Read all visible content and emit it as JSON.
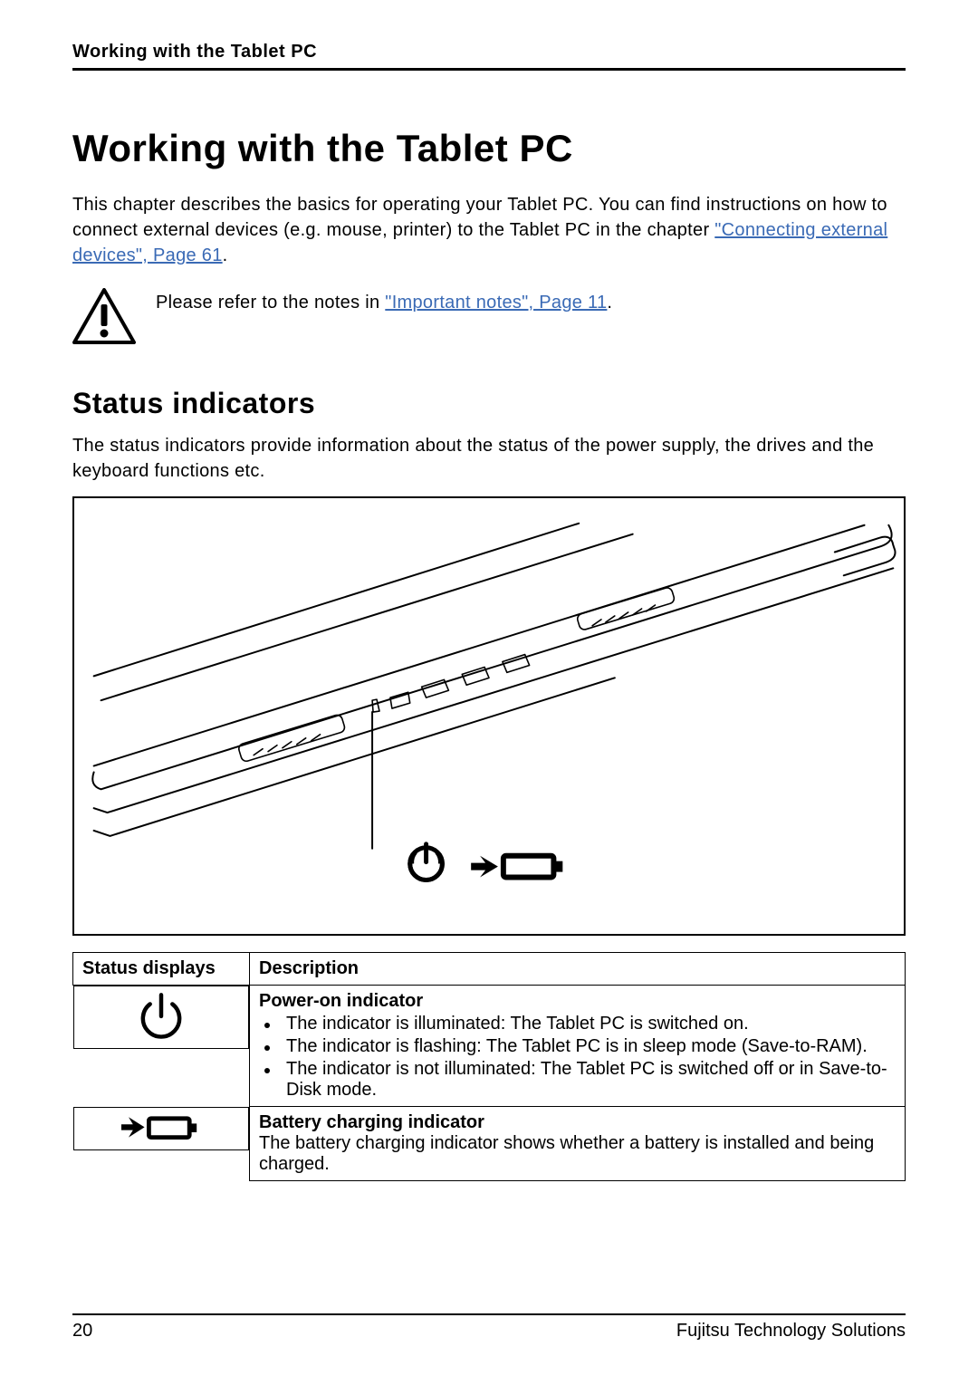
{
  "running_head": "Working with the Tablet PC",
  "h1": "Working with the Tablet PC",
  "intro_1": "This chapter describes the basics for operating your Tablet PC. You can find instructions on how to connect external devices (e.g. mouse, printer) to the Tablet PC in the chapter ",
  "intro_link": "\"Connecting external devices\", Page 61",
  "intro_2": ".",
  "note_prefix": "Please refer to the notes in ",
  "note_link": "\"Important notes\", Page 11",
  "note_suffix": ".",
  "h2": "Status indicators",
  "sub_intro": "The status indicators provide information about the status of the power supply, the drives and the keyboard functions etc.",
  "table": {
    "headers": {
      "col1": "Status displays",
      "col2": "Description"
    },
    "rows": [
      {
        "icon": "power-icon",
        "title": "Power-on indicator",
        "bullets": [
          "The indicator is illuminated: The Tablet PC is switched on.",
          "The indicator is flashing: The Tablet PC is in sleep mode (Save-to-RAM).",
          "The indicator is not illuminated: The Tablet PC is switched off or in Save-to-Disk mode."
        ]
      },
      {
        "icon": "battery-charging-icon",
        "title": "Battery charging indicator",
        "text": "The battery charging indicator shows whether a battery is installed and being charged."
      }
    ]
  },
  "footer": {
    "page": "20",
    "brand": "Fujitsu Technology Solutions"
  }
}
